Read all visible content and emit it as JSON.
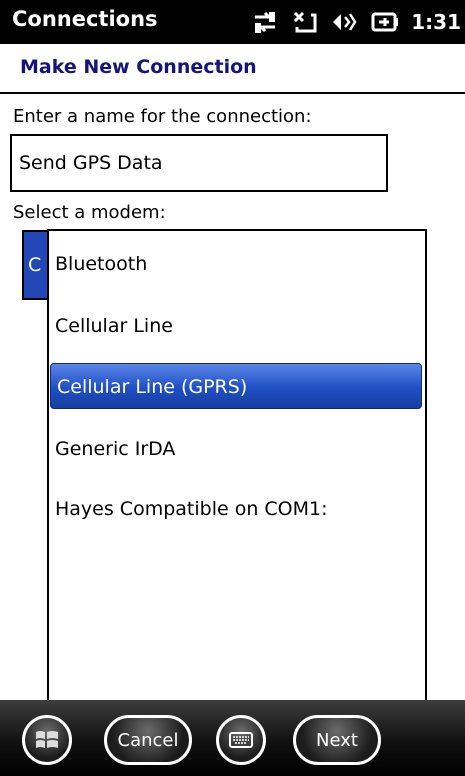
{
  "status_bar": {
    "app_title": "Connections",
    "clock": "1:31",
    "icons": [
      "connectivity-icon",
      "signal-icon",
      "volume-icon",
      "battery-icon"
    ]
  },
  "header": {
    "title": "Make New Connection"
  },
  "form": {
    "name_label": "Enter a name for the connection:",
    "name_value": "Send GPS Data",
    "modem_label": "Select a modem:",
    "modem_selected_partial": "C"
  },
  "dropdown": {
    "options": [
      {
        "label": "Bluetooth",
        "selected": false
      },
      {
        "label": "Cellular Line",
        "selected": false
      },
      {
        "label": "Cellular Line (GPRS)",
        "selected": true
      },
      {
        "label": "Generic IrDA",
        "selected": false
      },
      {
        "label": "Hayes Compatible on COM1:",
        "selected": false
      }
    ]
  },
  "bottom_bar": {
    "start_icon": "windows-start-icon",
    "cancel_label": "Cancel",
    "keyboard_icon": "keyboard-icon",
    "next_label": "Next"
  },
  "colors": {
    "selection": "#1f4fc3",
    "header_text": "#14147a",
    "status_bar_bg": "#000000"
  }
}
